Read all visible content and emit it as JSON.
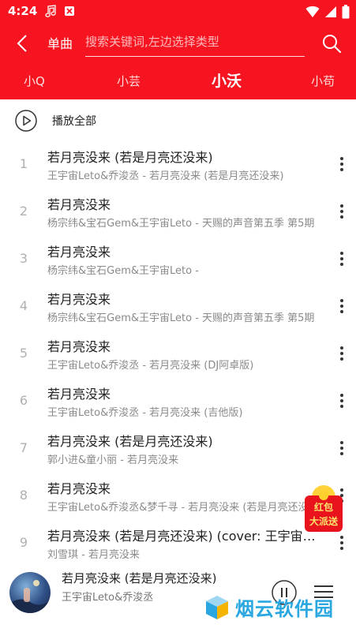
{
  "statusbar": {
    "time": "4:24"
  },
  "toolbar": {
    "search_type": "单曲",
    "search_placeholder": "搜索关键词,左边选择类型"
  },
  "tabs": [
    {
      "label": "小Q"
    },
    {
      "label": "小芸"
    },
    {
      "label": "小沃"
    },
    {
      "label": "小苟"
    }
  ],
  "play_all": {
    "label": "播放全部"
  },
  "songs": [
    {
      "index": "1",
      "title": "若月亮没来 (若是月亮还没来)",
      "subtitle": "王宇宙Leto&乔浚丞 - 若月亮没来 (若是月亮还没来)"
    },
    {
      "index": "2",
      "title": "若月亮没来",
      "subtitle": "杨宗纬&宝石Gem&王宇宙Leto - 天赐的声音第五季 第5期"
    },
    {
      "index": "3",
      "title": "若月亮没来",
      "subtitle": "杨宗纬&宝石Gem&王宇宙Leto -"
    },
    {
      "index": "4",
      "title": "若月亮没来",
      "subtitle": "杨宗纬&宝石Gem&王宇宙Leto - 天赐的声音第五季 第5期"
    },
    {
      "index": "5",
      "title": "若月亮没来",
      "subtitle": "王宇宙Leto&乔浚丞 - 若月亮没来 (DJ阿卓版)"
    },
    {
      "index": "6",
      "title": "若月亮没来",
      "subtitle": "王宇宙Leto&乔浚丞 - 若月亮没来 (吉他版)"
    },
    {
      "index": "7",
      "title": "若月亮没来 (若是月亮还没来)",
      "subtitle": "郭小进&童小丽 - 若月亮没来"
    },
    {
      "index": "8",
      "title": "若月亮没来",
      "subtitle": "王宇宙Leto&乔浚丞&梦千寻 - 若月亮没来 (若是月亮还没来)"
    },
    {
      "index": "9",
      "title": "若月亮没来 (若是月亮还没来) (cover: 王宇宙…",
      "subtitle": "刘雪琪 - 若月亮没来"
    }
  ],
  "redpacket": {
    "line1": "红包",
    "line2": "大派送"
  },
  "player": {
    "title": "若月亮没来 (若是月亮还没来)",
    "artist": "王宇宙Leto&乔浚丞"
  },
  "watermark": {
    "text": "烟云软件园"
  },
  "colors": {
    "accent": "#f5141f",
    "watermark": "#2aa7e0"
  }
}
